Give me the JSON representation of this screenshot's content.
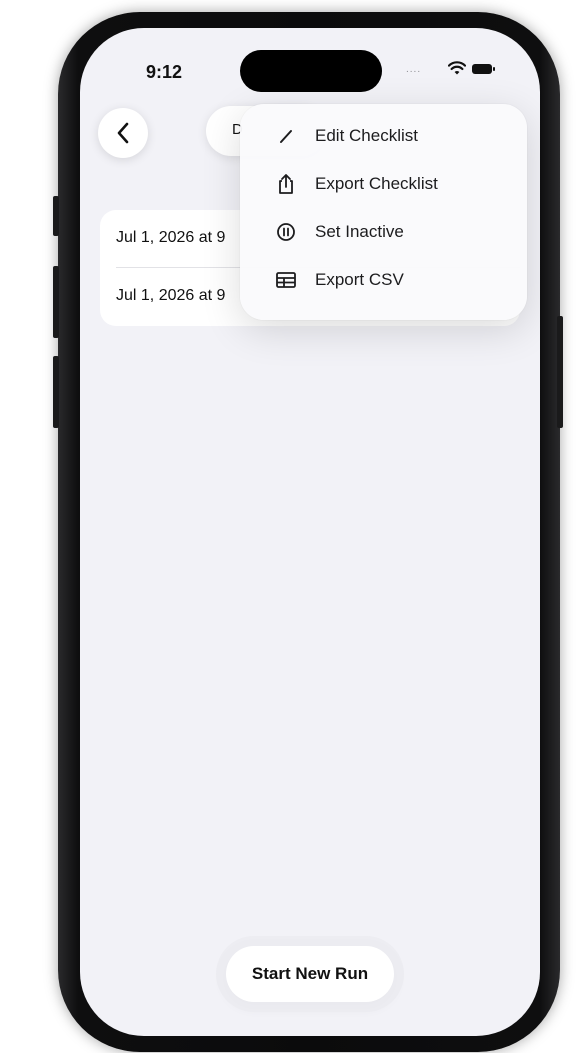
{
  "status_bar": {
    "time": "9:12",
    "signal": "....",
    "wifi_icon": "wifi-icon",
    "battery_icon": "battery-icon"
  },
  "nav": {
    "back_icon": "chevron-left-icon",
    "title_partial": "D"
  },
  "runs": [
    {
      "label": "Jul 1, 2026 at 9"
    },
    {
      "label": "Jul 1, 2026 at 9"
    }
  ],
  "menu": {
    "items": [
      {
        "label": "Edit Checklist",
        "icon": "pencil-icon"
      },
      {
        "label": "Export Checklist",
        "icon": "share-icon"
      },
      {
        "label": "Set Inactive",
        "icon": "pause-circle-icon"
      },
      {
        "label": "Export CSV",
        "icon": "table-icon"
      }
    ]
  },
  "footer": {
    "start_label": "Start New Run"
  },
  "colors": {
    "background": "#f2f2f7",
    "card": "#ffffff",
    "text": "#111111"
  }
}
